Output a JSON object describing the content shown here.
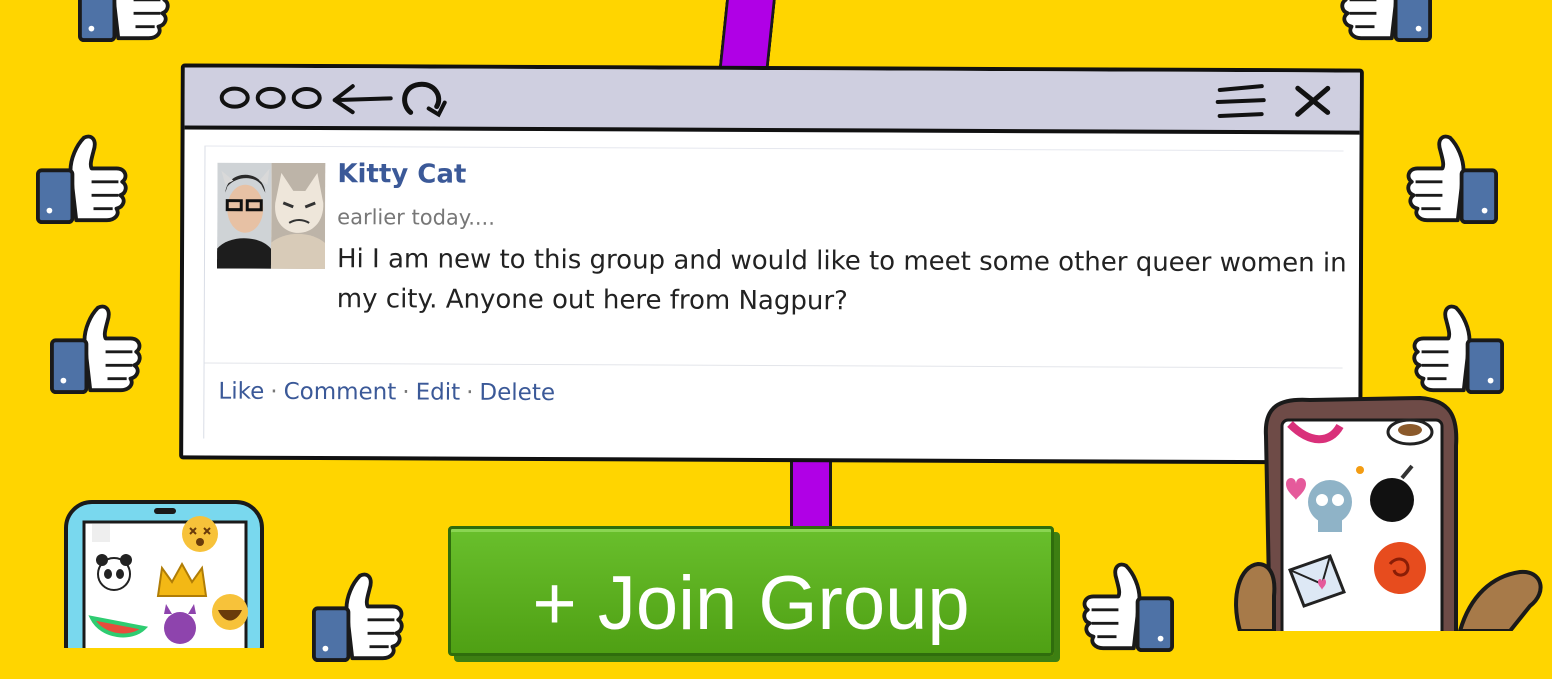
{
  "window": {
    "toolbar": {
      "left_icons": [
        "circle-icon",
        "circle-icon",
        "circle-icon",
        "back-arrow-icon",
        "refresh-icon"
      ],
      "right_icons": [
        "menu-icon",
        "close-icon"
      ]
    }
  },
  "post": {
    "author": "Kitty Cat",
    "time": "earlier today....",
    "message": "Hi I am new to this group and would like to meet some other queer women in my city. Anyone out here from Nagpur?",
    "actions": [
      "Like",
      "Comment",
      "Edit",
      "Delete"
    ],
    "separator": "·"
  },
  "join_button": {
    "label": "+ Join Group"
  },
  "colors": {
    "background": "#FFD500",
    "toolbar": "#CFCFE0",
    "link": "#3B5998",
    "button": "#5DB01E",
    "stem": "#B000E6"
  },
  "decorations": {
    "thumb_icon": "thumbs-up-icon",
    "left_phone": "emoji-phone",
    "right_phone": "sticker-phone"
  }
}
